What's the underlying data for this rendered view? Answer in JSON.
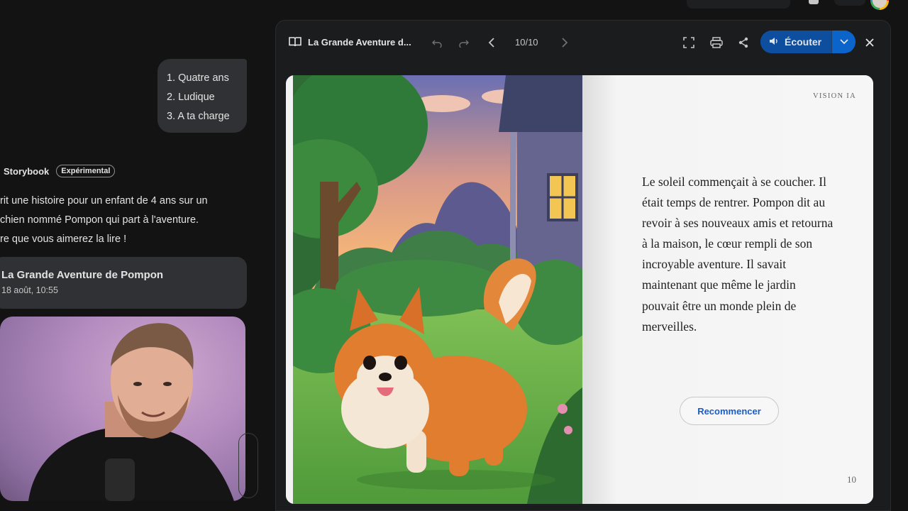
{
  "chat": {
    "user_message": [
      "1. Quatre ans",
      "2. Ludique",
      "3. A ta charge"
    ],
    "bot": {
      "name": "Storybook",
      "badge": "Expérimental",
      "lines": [
        "rit une histoire pour un enfant de 4 ans sur un",
        "chien nommé Pompon qui part à l'aventure.",
        "re que vous aimerez la lire !"
      ]
    },
    "story_card": {
      "title": "La Grande Aventure de Pompon",
      "date": "18 août, 10:55"
    }
  },
  "viewer": {
    "title": "La Grande Aventure d...",
    "pager": "10/10",
    "listen_label": "Écouter",
    "icons": {
      "book": "open-book-icon",
      "undo": "undo-icon",
      "redo": "redo-icon",
      "prev": "chevron-left-icon",
      "next": "chevron-right-icon",
      "fullscreen": "fullscreen-icon",
      "print": "print-icon",
      "share": "share-icon",
      "volume": "volume-icon",
      "dropdown": "chevron-down-icon",
      "close": "close-icon"
    }
  },
  "book": {
    "brand": "VISION IA",
    "text": "Le soleil commençait à se coucher. Il était temps de rentrer. Pompon dit au revoir à ses nouveaux amis et retourna à la maison, le cœur rempli de son incroyable aventure. Il savait maintenant que même le jardin pouvait être un monde plein de merveilles.",
    "restart_label": "Recommencer",
    "page_number": "10"
  },
  "colors": {
    "background": "#131314",
    "accent": "#0b57d0",
    "link": "#1a5dc8"
  }
}
